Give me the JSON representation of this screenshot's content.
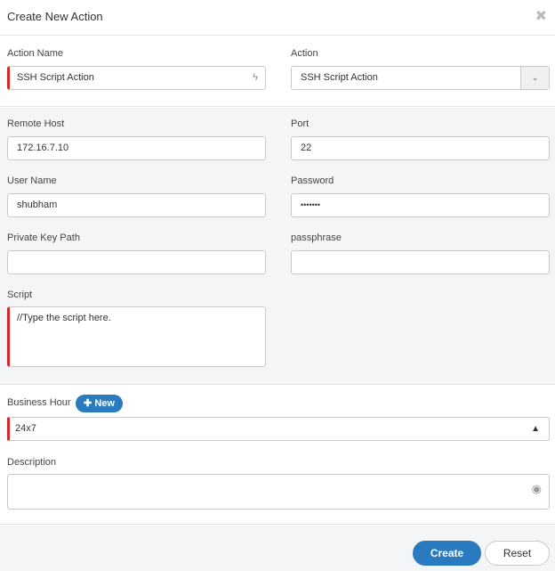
{
  "dialog": {
    "title": "Create New Action",
    "close_icon": "close-icon"
  },
  "action_name": {
    "label": "Action Name",
    "value": "SSH Script Action",
    "icon": "bolt-icon"
  },
  "action": {
    "label": "Action",
    "value": "SSH Script Action",
    "icon": "chevron-down-icon"
  },
  "remote_host": {
    "label": "Remote Host",
    "value": "172.16.7.10"
  },
  "port": {
    "label": "Port",
    "value": "22"
  },
  "user_name": {
    "label": "User Name",
    "value": "shubham"
  },
  "password": {
    "label": "Password",
    "value": "•••••••"
  },
  "private_key_path": {
    "label": "Private Key Path",
    "value": ""
  },
  "passphrase": {
    "label": "passphrase",
    "value": ""
  },
  "script": {
    "label": "Script",
    "placeholder": "//Type the script here."
  },
  "business_hour": {
    "label": "Business Hour",
    "new_button": "New",
    "value": "24x7"
  },
  "description": {
    "label": "Description",
    "value": "",
    "icon": "comment-icon"
  },
  "footer": {
    "create_label": "Create",
    "reset_label": "Reset"
  },
  "colors": {
    "accent": "#2a7ac0",
    "required": "#d9262b",
    "panel": "#f4f5f7"
  }
}
